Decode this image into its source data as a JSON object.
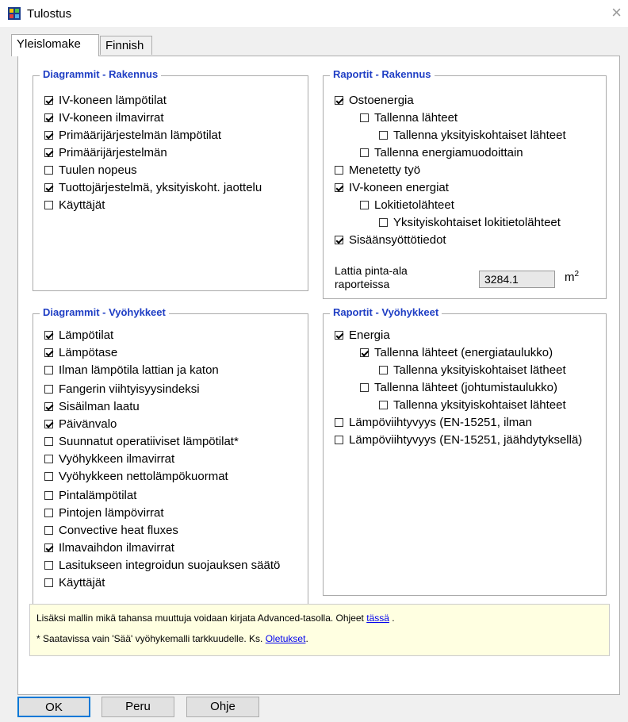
{
  "window": {
    "title": "Tulostus",
    "close_glyph": "×"
  },
  "tabs": [
    {
      "label": "Yleislomake",
      "active": true
    },
    {
      "label": "Finnish",
      "active": false
    }
  ],
  "diagrams_building": {
    "title": "Diagrammit - Rakennus",
    "items": [
      {
        "label": "IV-koneen lämpötilat",
        "checked": true
      },
      {
        "label": "IV-koneen ilmavirrat",
        "checked": true
      },
      {
        "label": "Primäärijärjestelmän lämpötilat",
        "checked": true
      },
      {
        "label": "Primäärijärjestelmän",
        "checked": true
      },
      {
        "label": "Tuulen nopeus",
        "checked": false
      },
      {
        "label": "Tuottojärjestelmä, yksityiskoht. jaottelu",
        "checked": true
      },
      {
        "label": "Käyttäjät",
        "checked": false
      }
    ]
  },
  "reports_building": {
    "title": "Raportit - Rakennus",
    "items": [
      {
        "label": "Ostoenergia",
        "checked": true
      },
      {
        "label": "Tallenna lähteet",
        "checked": false
      },
      {
        "label": "Tallenna yksityiskohtaiset lähteet",
        "checked": false
      },
      {
        "label": "Tallenna energiamuodoittain",
        "checked": false
      },
      {
        "label": "Menetetty työ",
        "checked": false
      },
      {
        "label": "IV-koneen energiat",
        "checked": true
      },
      {
        "label": "Lokitietolähteet",
        "checked": false
      },
      {
        "label": "Yksityiskohtaiset lokitietolähteet",
        "checked": false
      },
      {
        "label": "Sisäänsyöttötiedot",
        "checked": true
      }
    ],
    "floor_area_label_line1": "Lattia pinta-ala",
    "floor_area_label_line2": "raporteissa",
    "floor_area_value": "3284.1",
    "floor_area_unit": "m",
    "floor_area_unit_sup": "2"
  },
  "diagrams_zones": {
    "title": "Diagrammit - Vyöhykkeet",
    "items": [
      {
        "label": "Lämpötilat",
        "checked": true
      },
      {
        "label": "Lämpötase",
        "checked": true
      },
      {
        "label": "Ilman lämpötila lattian ja katon",
        "checked": false
      },
      {
        "label": "Fangerin viihtyisyysindeksi",
        "checked": false
      },
      {
        "label": "Sisäilman laatu",
        "checked": true
      },
      {
        "label": "Päivänvalo",
        "checked": true
      },
      {
        "label": "Suunnatut operatiiviset lämpötilat*",
        "checked": false
      },
      {
        "label": "Vyöhykkeen ilmavirrat",
        "checked": false
      },
      {
        "label": "Vyöhykkeen nettolämpökuormat",
        "checked": false
      },
      {
        "label": "Pintalämpötilat",
        "checked": false
      },
      {
        "label": "Pintojen lämpövirrat",
        "checked": false
      },
      {
        "label": "Convective heat fluxes",
        "checked": false
      },
      {
        "label": "Ilmavaihdon ilmavirrat",
        "checked": true
      },
      {
        "label": "Lasitukseen integroidun suojauksen säätö",
        "checked": false
      },
      {
        "label": "Käyttäjät",
        "checked": false
      }
    ]
  },
  "reports_zones": {
    "title": "Raportit - Vyöhykkeet",
    "items": [
      {
        "label": "Energia",
        "checked": true
      },
      {
        "label": "Tallenna lähteet (energiataulukko)",
        "checked": true
      },
      {
        "label": "Tallenna yksityiskohtaiset lätheet",
        "checked": false
      },
      {
        "label": "Tallenna lähteet (johtumistaulukko)",
        "checked": false
      },
      {
        "label": "Tallenna yksityiskohtaiset lähteet",
        "checked": false
      },
      {
        "label": "Lämpöviihtyvyys (EN-15251, ilman",
        "checked": false
      },
      {
        "label": "Lämpöviihtyvyys (EN-15251, jäähdytyksellä)",
        "checked": false
      }
    ]
  },
  "note": {
    "line1_text": "Lisäksi mallin mikä tahansa muuttuja voidaan kirjata Advanced-tasolla. Ohjeet",
    "line1_link": "tässä",
    "line1_end": ".",
    "line2_text": "* Saatavissa vain 'Sää' vyöhykemalli tarkkuudelle. Ks.",
    "line2_link": "Oletukset",
    "line2_end": "."
  },
  "buttons": {
    "ok": "OK",
    "cancel": "Peru",
    "help": "Ohje"
  },
  "icons": {
    "app": "app-grid-icon",
    "checkbox_checked": "checkmark-icon"
  }
}
